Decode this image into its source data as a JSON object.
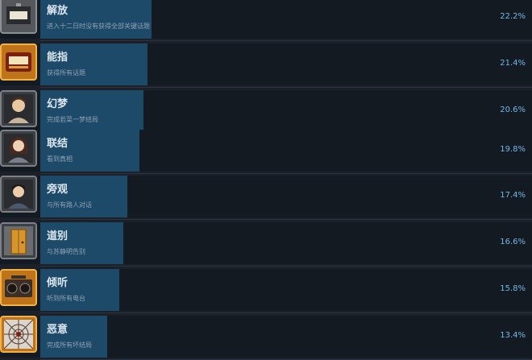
{
  "achievements": [
    {
      "name": "解放",
      "description": "进入十二日时没有获得全部关键话题",
      "percent_text": "22.2%",
      "percent": 22.2,
      "icon": "suitcase-icon"
    },
    {
      "name": "能指",
      "description": "获得所有话题",
      "percent_text": "21.4%",
      "percent": 21.4,
      "icon": "book-icon"
    },
    {
      "name": "幻梦",
      "description": "完成若菜一梦结局",
      "percent_text": "20.6%",
      "percent": 20.6,
      "icon": "portrait-man-icon"
    },
    {
      "name": "联结",
      "description": "看到真相",
      "percent_text": "19.8%",
      "percent": 19.8,
      "icon": "portrait-girl-icon"
    },
    {
      "name": "旁观",
      "description": "与所有路人对话",
      "percent_text": "17.4%",
      "percent": 17.4,
      "icon": "portrait-boy-icon"
    },
    {
      "name": "道别",
      "description": "与苏静明告别",
      "percent_text": "16.6%",
      "percent": 16.6,
      "icon": "door-icon"
    },
    {
      "name": "倾听",
      "description": "听到所有电台",
      "percent_text": "15.8%",
      "percent": 15.8,
      "icon": "radio-icon"
    },
    {
      "name": "恶意",
      "description": "完成所有坏结局",
      "percent_text": "13.4%",
      "percent": 13.4,
      "icon": "web-icon"
    }
  ]
}
